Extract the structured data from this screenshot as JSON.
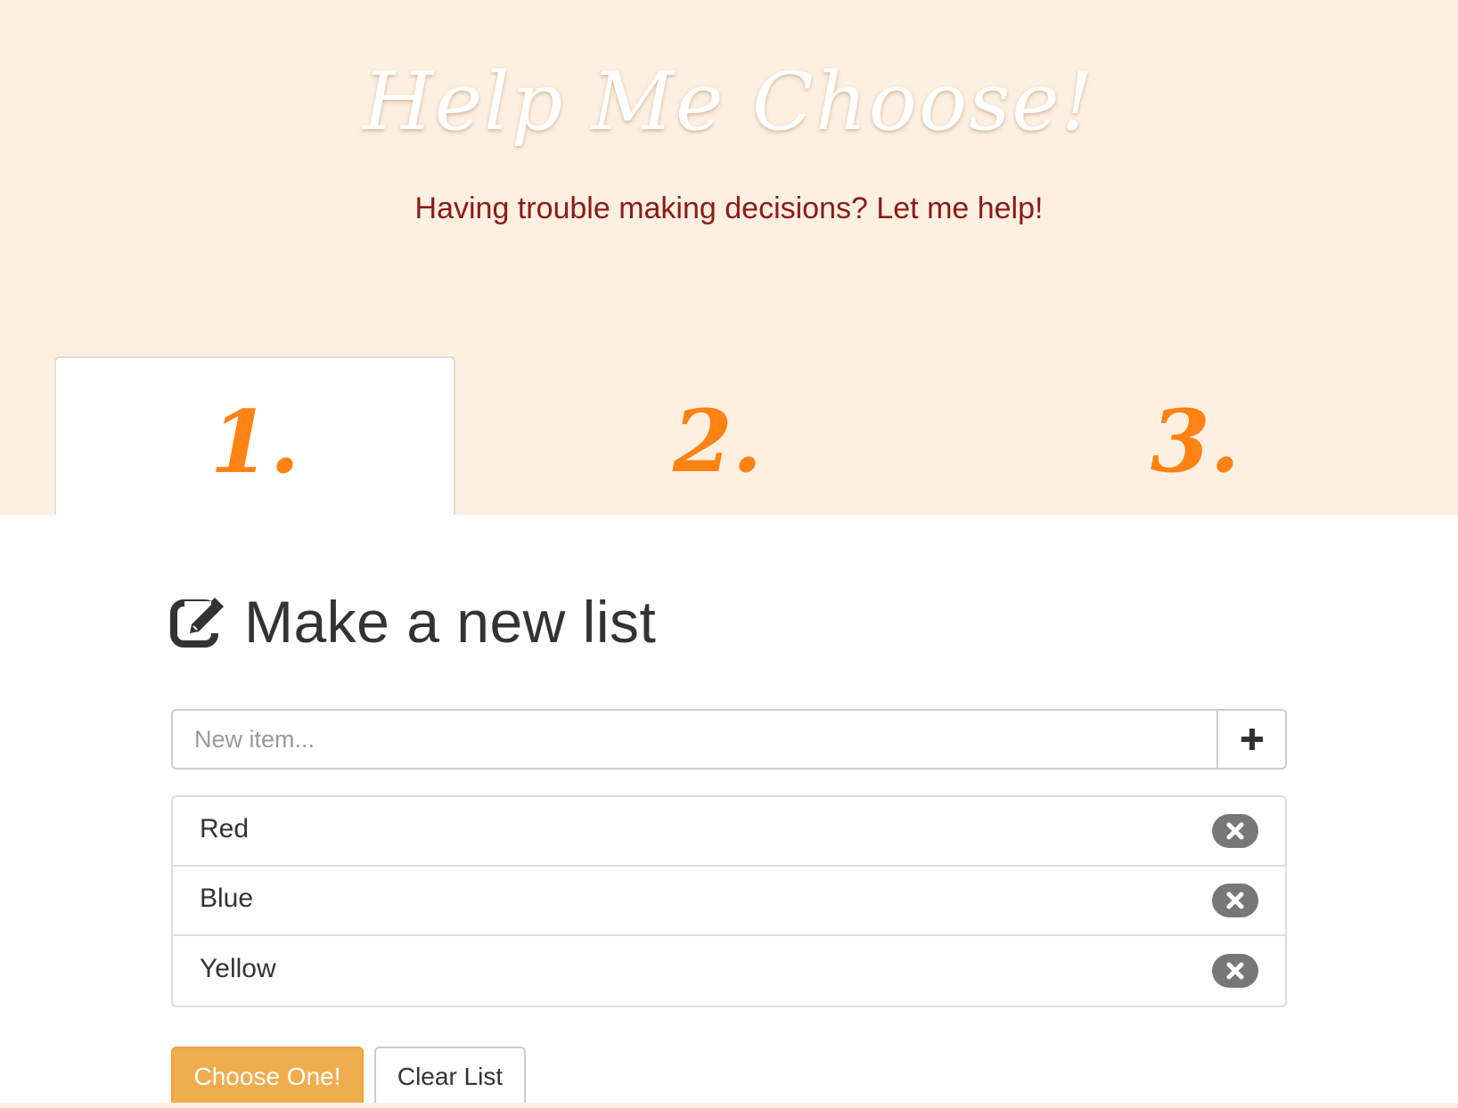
{
  "hero": {
    "title": "Help Me Choose!",
    "subtitle": "Having trouble making decisions? Let me help!"
  },
  "tabs": [
    {
      "label": "1.",
      "active": true
    },
    {
      "label": "2.",
      "active": false
    },
    {
      "label": "3.",
      "active": false
    }
  ],
  "section": {
    "icon": "edit-icon",
    "title": "Make a new list"
  },
  "new_item": {
    "placeholder": "New item...",
    "value": "",
    "add_icon": "plus-icon"
  },
  "list": {
    "items": [
      {
        "label": "Red",
        "remove_icon": "remove-icon"
      },
      {
        "label": "Blue",
        "remove_icon": "remove-icon"
      },
      {
        "label": "Yellow",
        "remove_icon": "remove-icon"
      }
    ]
  },
  "actions": {
    "choose_label": "Choose One!",
    "clear_label": "Clear List"
  },
  "colors": {
    "hero_bg": "#fdf0e1",
    "subtitle": "#8b1a16",
    "tab_number": "#ff8312",
    "choose_button": "#f0ad4e",
    "remove_button": "#777777"
  }
}
